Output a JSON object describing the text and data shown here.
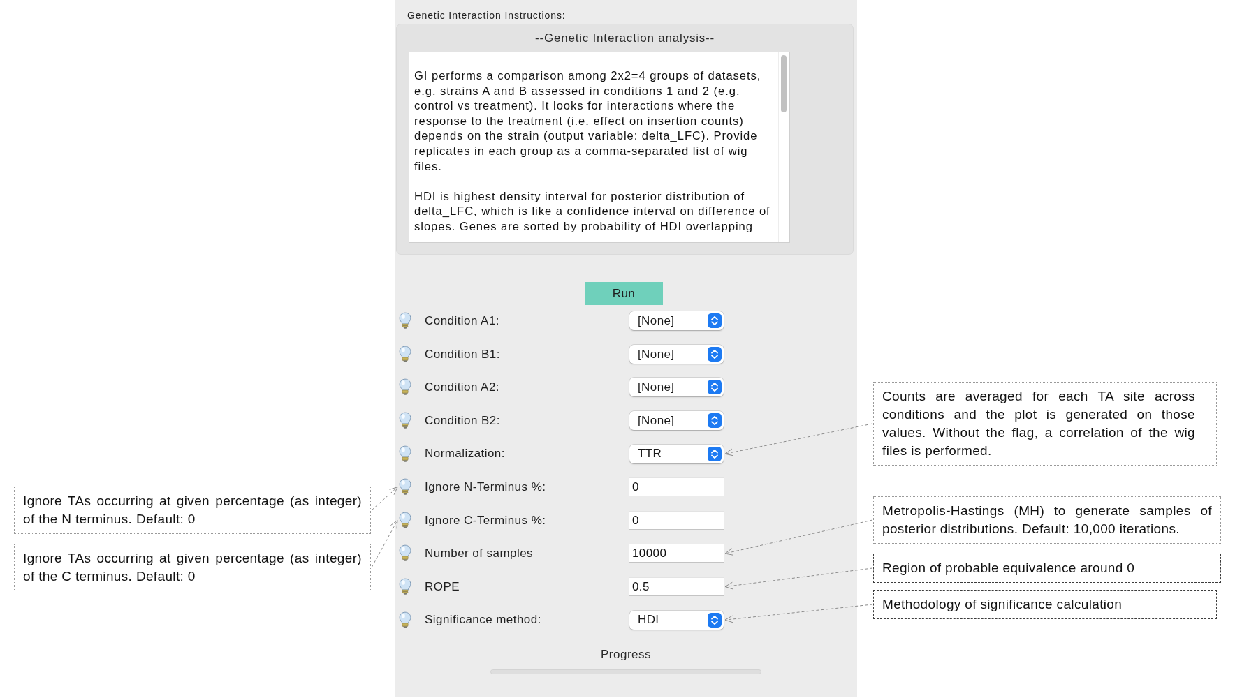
{
  "panel": {
    "instructions_label": "Genetic Interaction Instructions:",
    "instructions": {
      "heading": "--Genetic Interaction analysis--",
      "paragraphs": [
        "GI performs a comparison among 2x2=4 groups of datasets, e.g. strains A and B assessed in conditions 1 and 2 (e.g. control vs treatment). It looks for interactions where the response to the treatment (i.e. effect on insertion counts) depends on the strain (output variable: delta_LFC). Provide replicates in each group as a comma-separated list of wig files.",
        "HDI is highest density interval for posterior distribution of delta_LFC, which is like a confidence interval on difference of slopes. Genes are sorted by probability of HDI overlapping"
      ]
    },
    "run_button": "Run",
    "fields": [
      {
        "kind": "select",
        "label": "Condition A1:",
        "value": "[None]"
      },
      {
        "kind": "select",
        "label": "Condition B1:",
        "value": "[None]"
      },
      {
        "kind": "select",
        "label": "Condition A2:",
        "value": "[None]"
      },
      {
        "kind": "select",
        "label": "Condition B2:",
        "value": "[None]"
      },
      {
        "kind": "select",
        "label": "Normalization:",
        "value": "TTR",
        "callout": {
          "kind": "dotted",
          "text": "Counts are averaged for each TA site across conditions and the plot is generated on those values. Without the flag, a correlation of the wig files is performed."
        }
      },
      {
        "kind": "input",
        "label": "Ignore N-Terminus %:",
        "value": "0",
        "callout": {
          "kind": "dotted",
          "text": "Ignore TAs occurring at given percentage (as integer) of the N terminus. Default: 0"
        }
      },
      {
        "kind": "input",
        "label": "Ignore C-Terminus %:",
        "value": "0",
        "callout": {
          "kind": "dotted",
          "text": "Ignore TAs occurring at given percentage (as integer) of the C terminus. Default: 0"
        }
      },
      {
        "kind": "input",
        "label": "Number of samples",
        "value": "10000",
        "callout": {
          "kind": "dotted",
          "text": "Metropolis-Hastings (MH) to generate samples of posterior distributions. Default: 10,000 iterations."
        }
      },
      {
        "kind": "input",
        "label": "ROPE",
        "value": "0.5",
        "callout": {
          "kind": "dashed",
          "text": "Region of probable equivalence around 0"
        }
      },
      {
        "kind": "select",
        "label": "Significance method:",
        "value": "HDI",
        "callout": {
          "kind": "dashed",
          "text": "Methodology of significance calculation"
        }
      }
    ],
    "progress": {
      "label": "Progress",
      "level": 0
    }
  }
}
